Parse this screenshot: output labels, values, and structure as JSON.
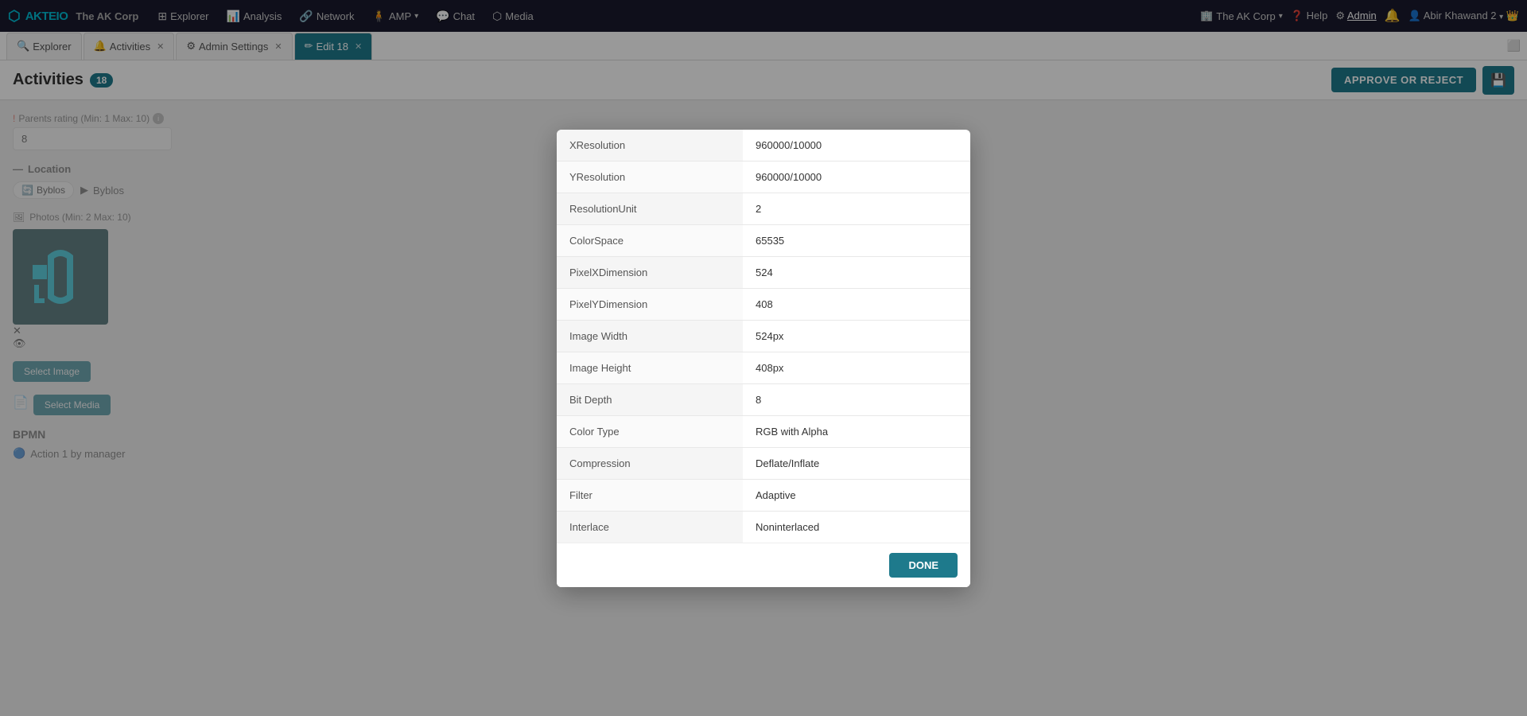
{
  "brand": {
    "logo_text": "AKTEIO",
    "company": "The AK Corp"
  },
  "nav": {
    "items": [
      {
        "icon": "⊞",
        "label": "Explorer"
      },
      {
        "icon": "📊",
        "label": "Analysis"
      },
      {
        "icon": "🔗",
        "label": "Network"
      },
      {
        "icon": "🧍",
        "label": "AMP",
        "has_dropdown": true
      },
      {
        "icon": "💬",
        "label": "Chat"
      },
      {
        "icon": "⬡",
        "label": "Media"
      }
    ],
    "right": {
      "company": "The AK Corp",
      "help": "Help",
      "admin": "Admin",
      "user": "Abir Khawand 2"
    }
  },
  "tabs": [
    {
      "icon": "🔍",
      "label": "Explorer",
      "closable": false,
      "active": false
    },
    {
      "icon": "🔔",
      "label": "Activities",
      "closable": true,
      "active": false
    },
    {
      "icon": "⚙",
      "label": "Admin Settings",
      "closable": true,
      "active": false
    },
    {
      "icon": "✏",
      "label": "Edit 18",
      "closable": true,
      "active": true
    }
  ],
  "page_header": {
    "title": "Activities",
    "badge": "18",
    "approve_label": "APPROVE OR REJECT",
    "save_icon": "💾"
  },
  "background_form": {
    "parents_rating_label": "Parents rating (Min: 1 Max: 10)",
    "parents_rating_value": "8",
    "location_label": "Location",
    "location_tag": "Byblos",
    "location_tree": "Byblos",
    "photos_label": "Photos (Min: 2 Max: 10)",
    "select_image_label": "Select Image",
    "select_media_label": "Select Media",
    "bpmn_label": "BPMN",
    "bpmn_action": "Action 1 by manager"
  },
  "modal": {
    "rows": [
      {
        "key": "XResolution",
        "value": "960000/10000"
      },
      {
        "key": "YResolution",
        "value": "960000/10000"
      },
      {
        "key": "ResolutionUnit",
        "value": "2"
      },
      {
        "key": "ColorSpace",
        "value": "65535"
      },
      {
        "key": "PixelXDimension",
        "value": "524"
      },
      {
        "key": "PixelYDimension",
        "value": "408"
      },
      {
        "key": "Image Width",
        "value": "524px"
      },
      {
        "key": "Image Height",
        "value": "408px"
      },
      {
        "key": "Bit Depth",
        "value": "8"
      },
      {
        "key": "Color Type",
        "value": "RGB with Alpha"
      },
      {
        "key": "Compression",
        "value": "Deflate/Inflate"
      },
      {
        "key": "Filter",
        "value": "Adaptive"
      },
      {
        "key": "Interlace",
        "value": "Noninterlaced"
      }
    ],
    "done_label": "DONE"
  },
  "colors": {
    "primary": "#1e7a8c",
    "danger": "#e74c3c",
    "bg_dark": "#0a3a40"
  }
}
